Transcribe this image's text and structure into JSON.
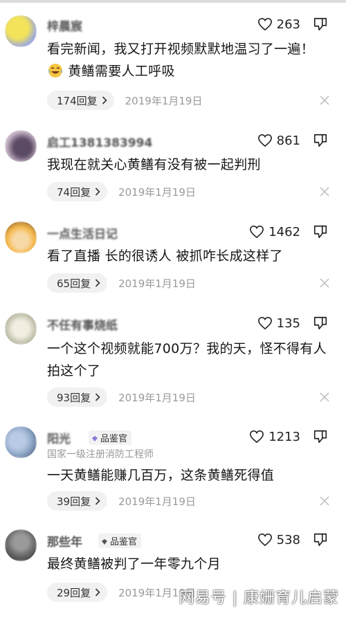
{
  "comments": [
    {
      "username": "梓晨宸",
      "likes": "263",
      "text_parts": [
        "看完新闻，我又打开视频默默地温习了一遍！",
        "黄鳝需要人工呼吸"
      ],
      "replies": "174回复",
      "date": "2019年1月19日",
      "avatar_colors": [
        "#e8d84a",
        "#9aa7e0"
      ]
    },
    {
      "username": "启工1381383994",
      "likes": "861",
      "text": "我现在就关心黄鳝有没有被一起判刑",
      "replies": "74回复",
      "date": "2019年1月19日",
      "avatar_colors": [
        "#c7b6c8",
        "#5b4a63"
      ]
    },
    {
      "username": "一点生活日记",
      "likes": "1462",
      "text": "看了直播 长的很诱人 被抓咋长成这样了",
      "replies": "65回复",
      "date": "2019年1月19日",
      "avatar_colors": [
        "#f5b84a",
        "#6b4a2a"
      ]
    },
    {
      "username": "不任有事烧纸",
      "likes": "135",
      "text": "一个这个视频就能700万？我的天，怪不得有人拍这个了",
      "replies": "93回复",
      "date": "2019年1月19日",
      "avatar_colors": [
        "#e0ddd0",
        "#a8a898"
      ]
    },
    {
      "username": "阳光",
      "badge": "品鉴官",
      "subtitle": "国家一级注册消防工程师",
      "likes": "1213",
      "text": "一天黄鳝能赚几百万，这条黄鳝死得值",
      "replies": "39回复",
      "date": "2019年1月19日",
      "avatar_colors": [
        "#8fa7c8",
        "#3a4a66"
      ]
    },
    {
      "username": "那些年",
      "badge": "品鉴官",
      "likes": "538",
      "text": "最终黄鳝被判了一年零九个月",
      "replies": "29回复",
      "date": "2019年1月19日",
      "avatar_colors": [
        "#6a6a6a",
        "#2a2a2a"
      ]
    }
  ],
  "watermark": "网易号 | 康姗育儿启蒙",
  "colors": {
    "badge_accent": "#8b7bd8",
    "icon": "#222222",
    "meta_text": "#9a9a9a"
  },
  "icons": [
    "heart-outline-icon",
    "thumbs-down-icon",
    "chevron-right-icon",
    "close-icon",
    "crying-laughing-emoji"
  ]
}
